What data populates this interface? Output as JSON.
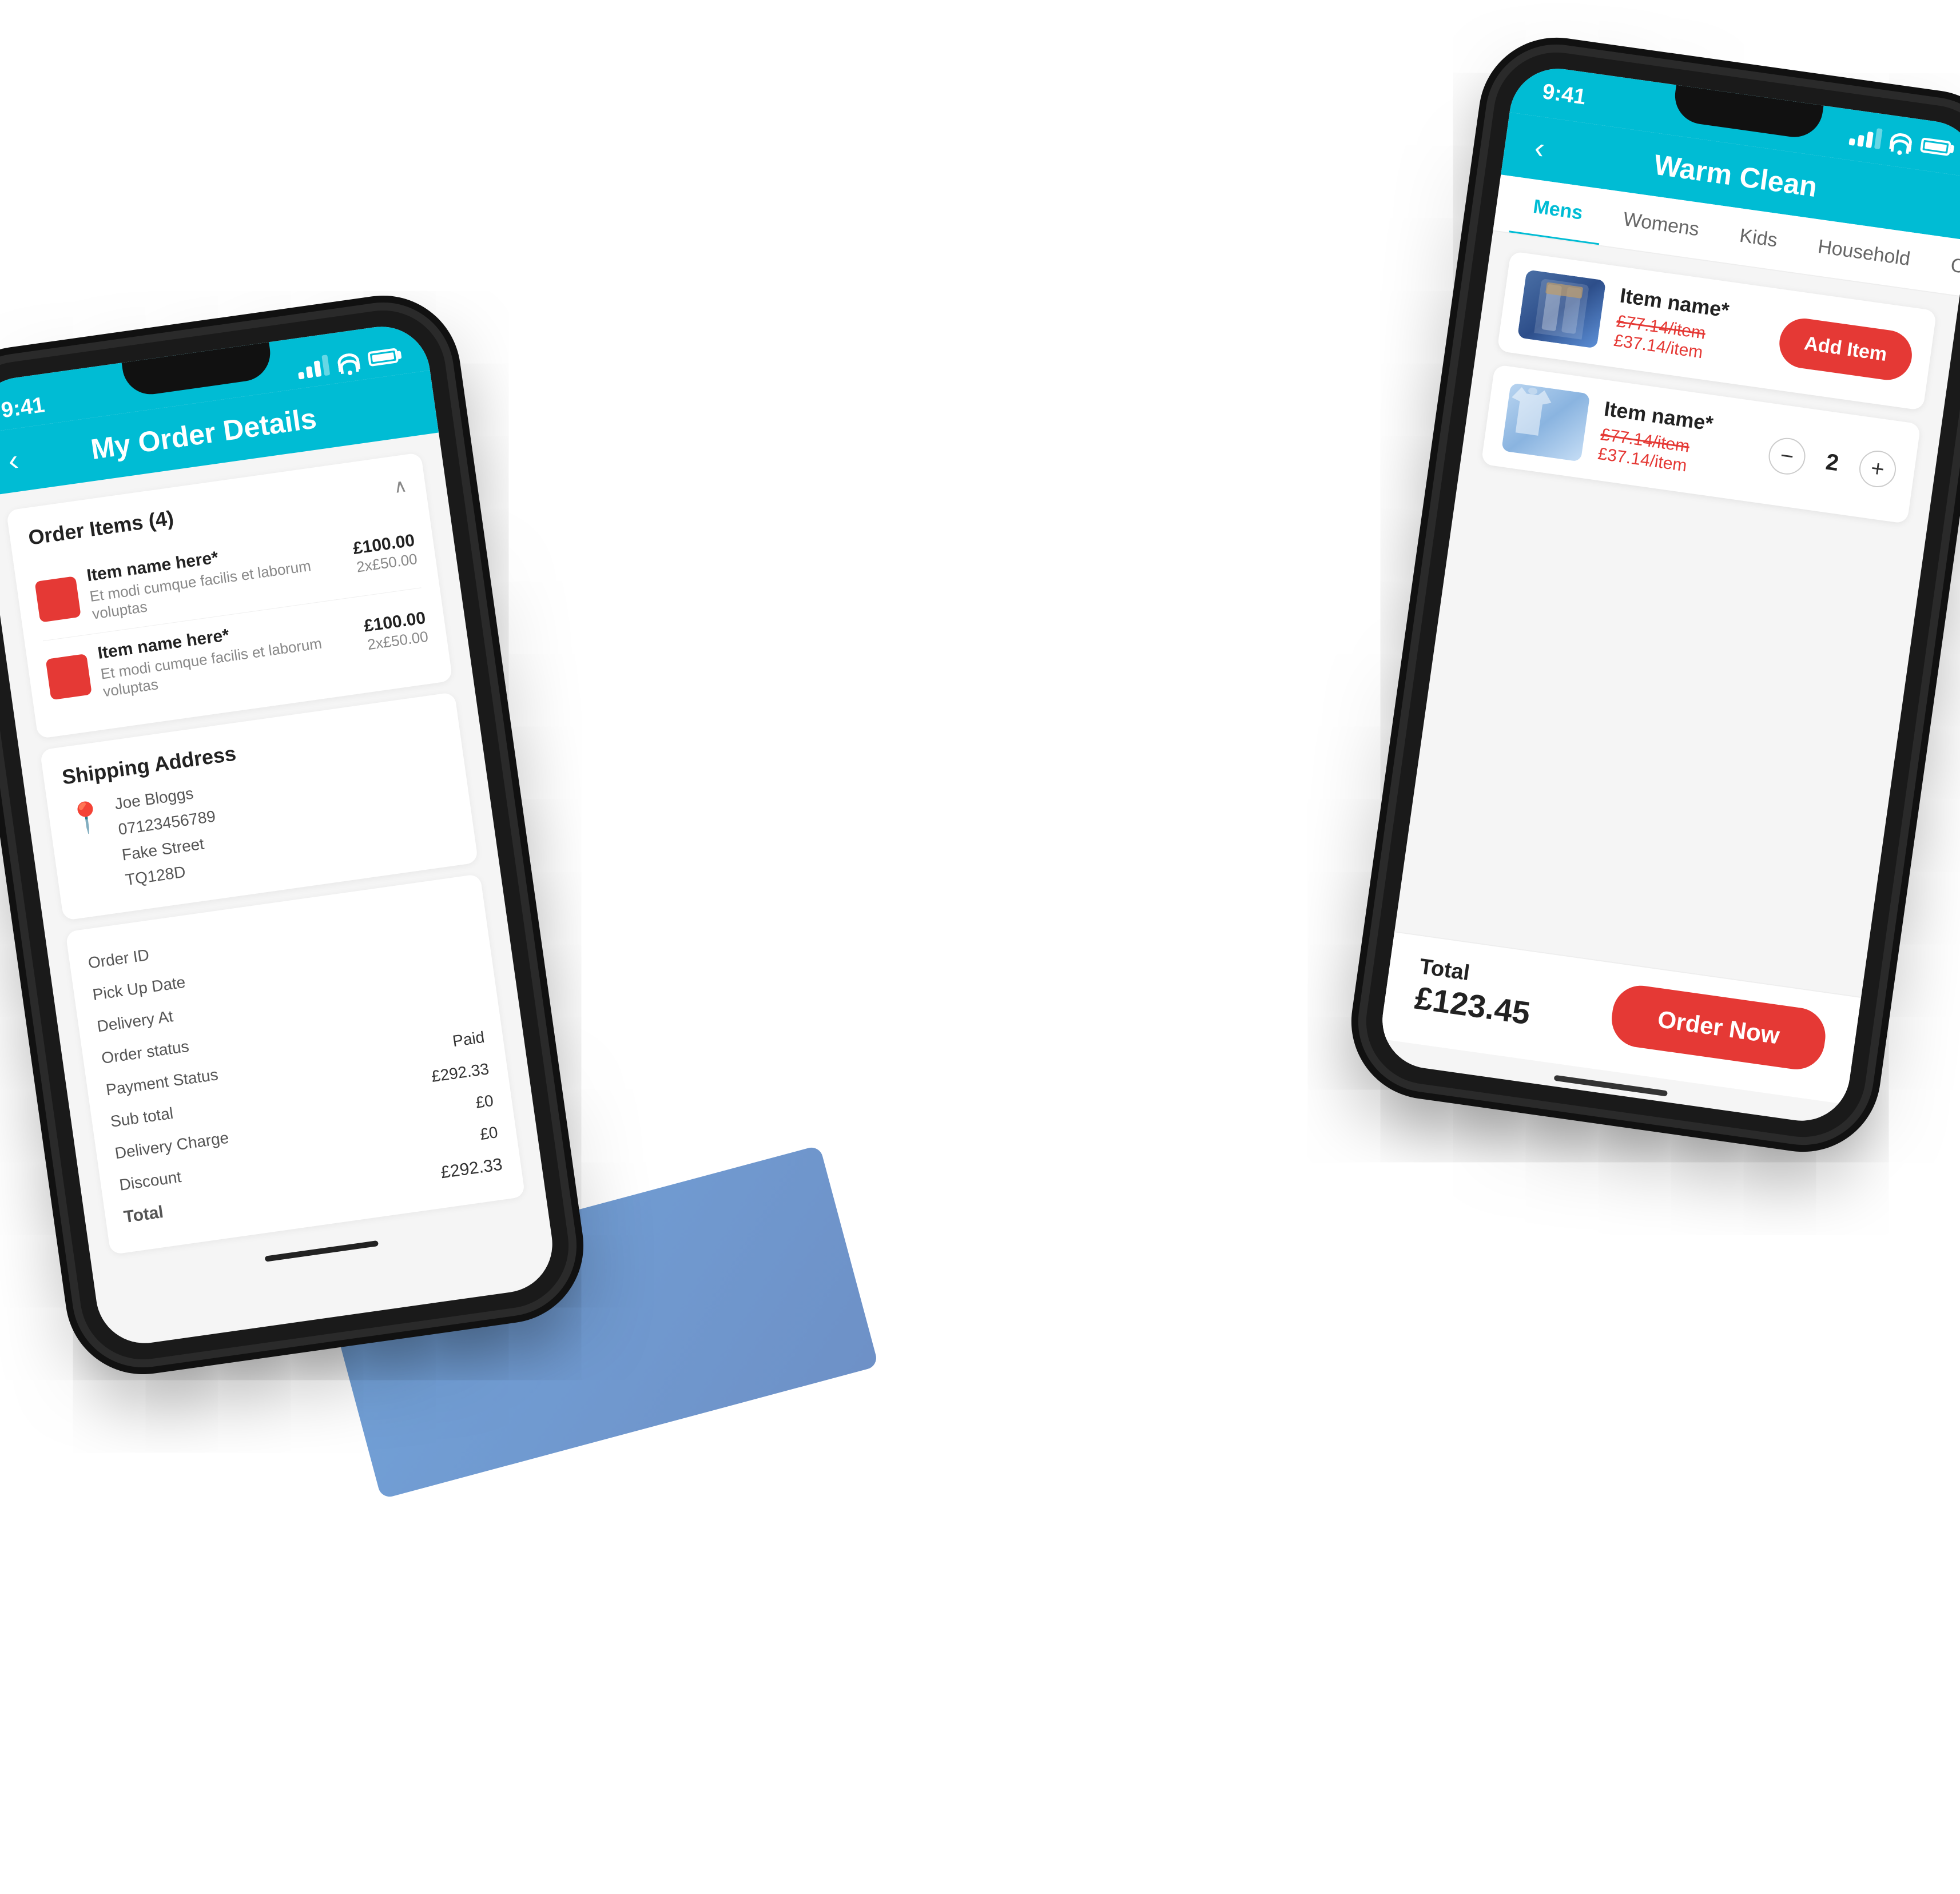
{
  "app": {
    "background_color": "#ffffff"
  },
  "phone_left": {
    "status_bar": {
      "time": "9:41",
      "signal": "signal",
      "wifi": "wifi",
      "battery": "battery"
    },
    "header": {
      "back_label": "‹",
      "title": "My Order Details"
    },
    "order_section": {
      "title": "Order Items (4)",
      "items": [
        {
          "name": "Item name here*",
          "description": "Et modi cumque facilis et laborum voluptas",
          "total": "£100.00",
          "qty_price": "2x£50.00"
        },
        {
          "name": "Item name here*",
          "description": "Et modi cumque facilis et laborum voluptas",
          "total": "£100.00",
          "qty_price": "2x£50.00"
        }
      ]
    },
    "shipping": {
      "title": "Shipping Address",
      "name": "Joe Bloggs",
      "phone": "07123456789",
      "street": "Fake Street",
      "postcode": "TQ128D"
    },
    "order_info": {
      "order_id_label": "Order ID",
      "order_id_value": "",
      "pickup_date_label": "Pick Up Date",
      "pickup_date_value": "",
      "delivery_at_label": "Delivery At",
      "delivery_at_value": "",
      "order_status_label": "Order status",
      "order_status_value": "",
      "payment_status_label": "Payment Status",
      "payment_status_value": "Paid",
      "sub_total_label": "Sub total",
      "sub_total_value": "£292.33",
      "delivery_charge_label": "Delivery Charge",
      "delivery_charge_value": "£0",
      "discount_label": "Discount",
      "discount_value": "£0",
      "total_label": "Total",
      "total_value": "£292.33"
    }
  },
  "phone_right": {
    "status_bar": {
      "time": "9:41",
      "signal": "signal",
      "wifi": "wifi",
      "battery": "battery"
    },
    "header": {
      "back_label": "‹",
      "title": "Warm Clean"
    },
    "tabs": [
      {
        "label": "Mens",
        "active": true
      },
      {
        "label": "Womens",
        "active": false
      },
      {
        "label": "Kids",
        "active": false
      },
      {
        "label": "Household",
        "active": false
      },
      {
        "label": "Others",
        "active": false
      }
    ],
    "items": [
      {
        "name": "Item name*",
        "price_original": "£77.14/item",
        "price_discounted": "£37.14/item",
        "has_add_button": true,
        "qty": null,
        "add_label": "Add Item"
      },
      {
        "name": "Item name*",
        "price_original": "£77.14/item",
        "price_discounted": "£37.14/item",
        "has_add_button": false,
        "qty": 2,
        "add_label": null
      }
    ],
    "footer": {
      "total_label": "Total",
      "total_amount": "£123.45",
      "order_now_label": "Order Now"
    }
  }
}
